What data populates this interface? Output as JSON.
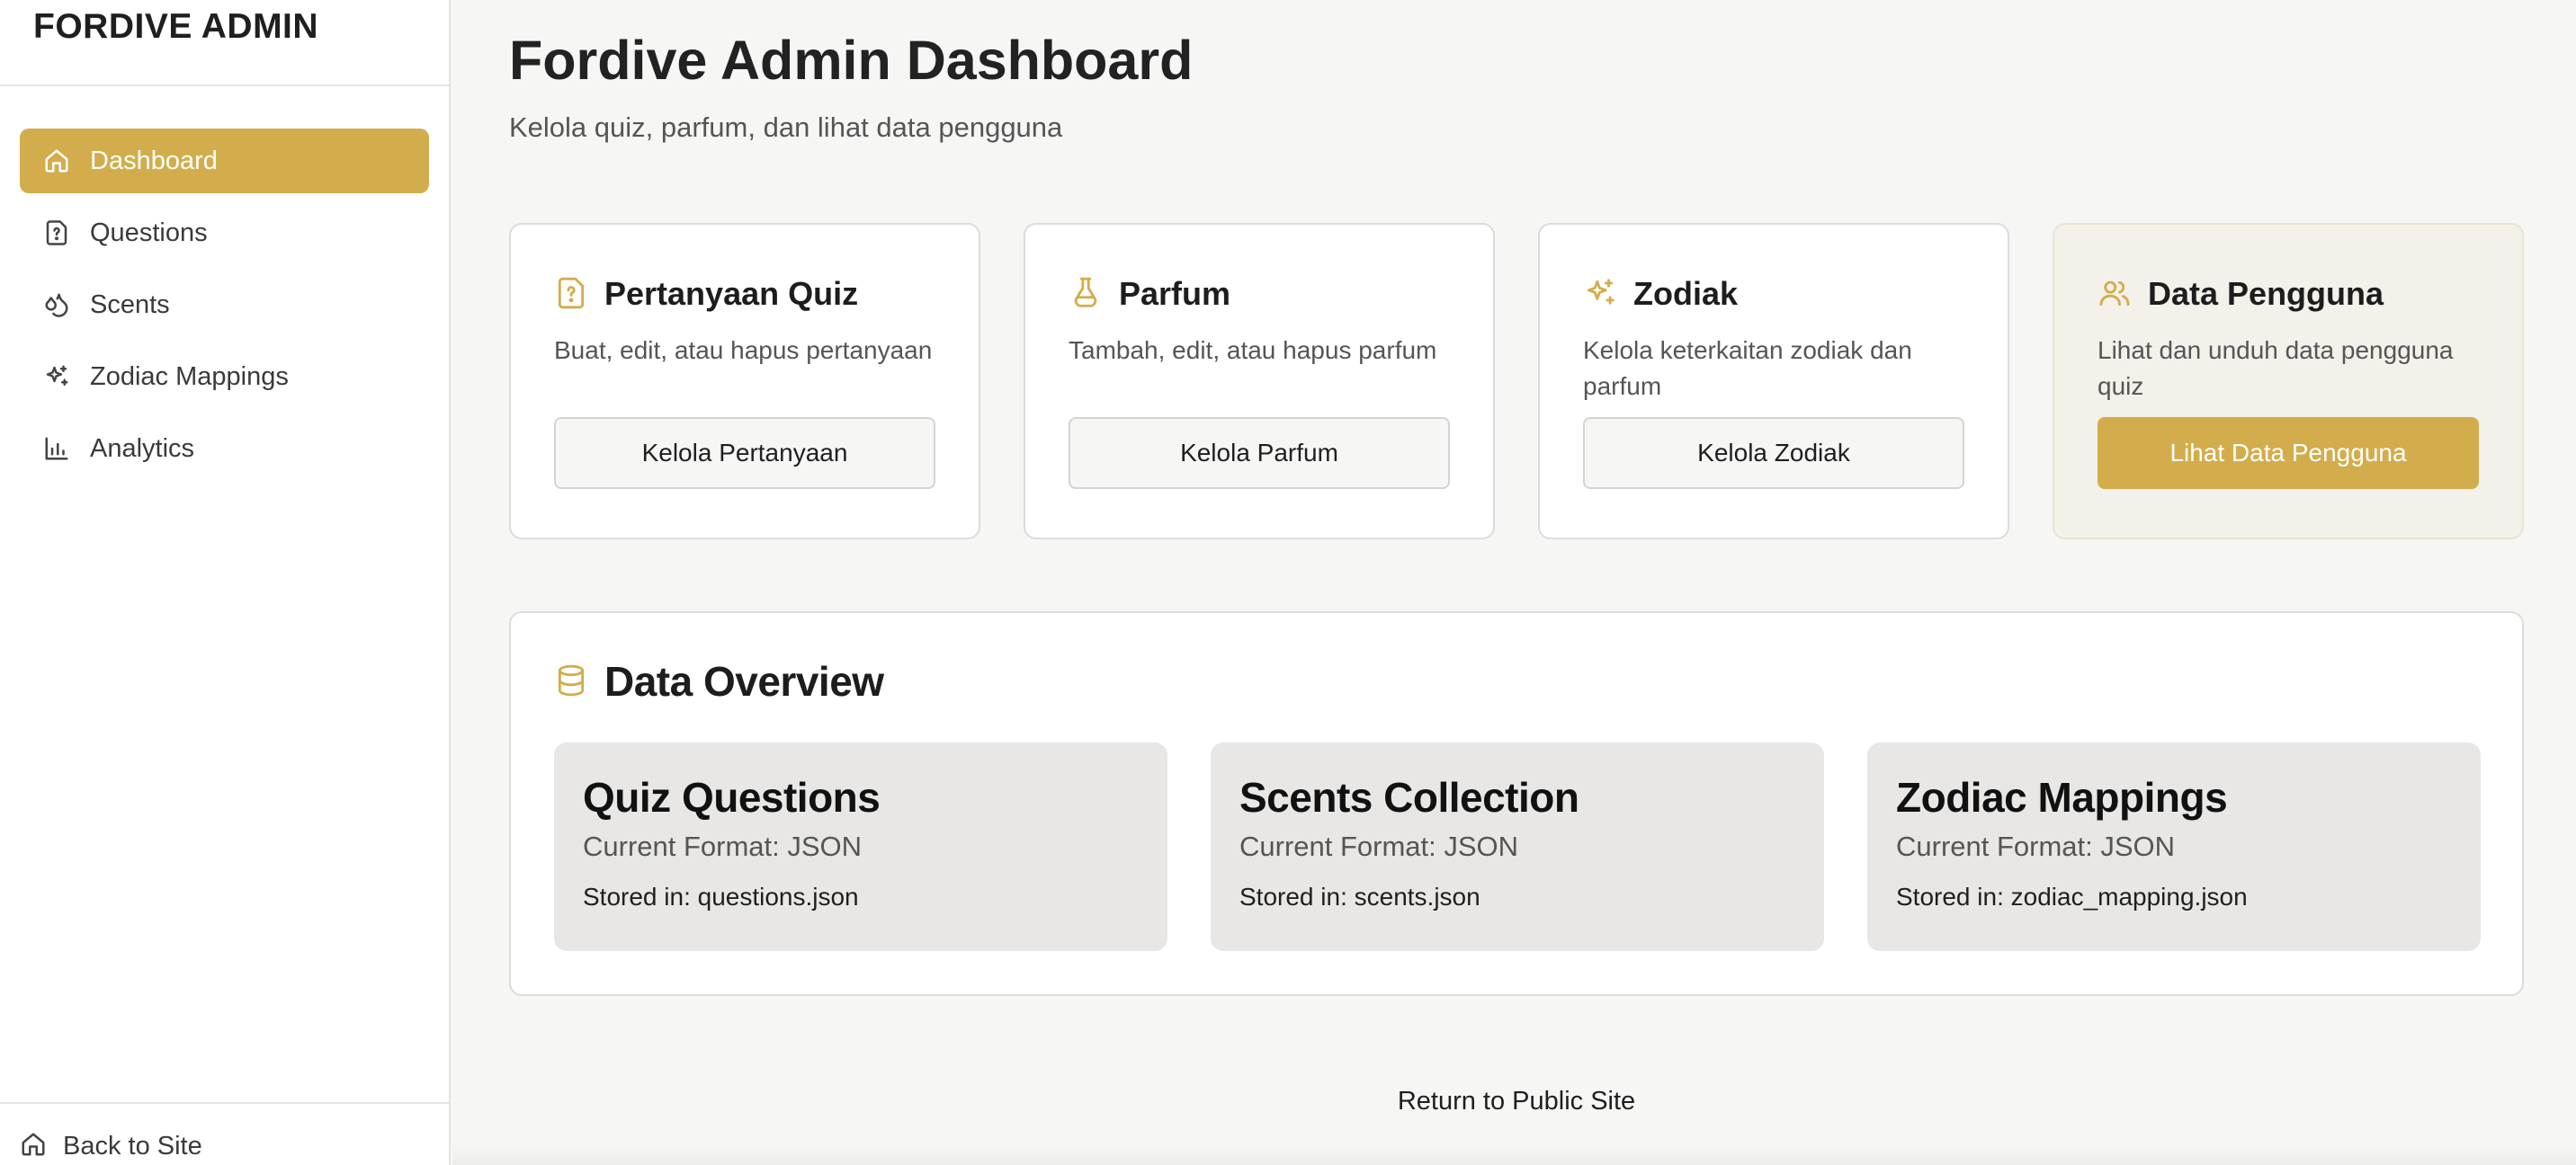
{
  "brand": {
    "name": "FORDIVE ADMIN"
  },
  "sidebar": {
    "items": [
      {
        "label": "Dashboard",
        "icon": "home-icon",
        "active": true
      },
      {
        "label": "Questions",
        "icon": "file-question-icon",
        "active": false
      },
      {
        "label": "Scents",
        "icon": "droplets-icon",
        "active": false
      },
      {
        "label": "Zodiac Mappings",
        "icon": "sparkles-icon",
        "active": false
      },
      {
        "label": "Analytics",
        "icon": "bar-chart-icon",
        "active": false
      }
    ],
    "footer_label": "Back to Site"
  },
  "page": {
    "title": "Fordive Admin Dashboard",
    "subtitle": "Kelola quiz, parfum, dan lihat data pengguna"
  },
  "cards": [
    {
      "title": "Pertanyaan Quiz",
      "description": "Buat, edit, atau hapus pertanyaan",
      "button": "Kelola Pertanyaan",
      "icon": "file-question-icon"
    },
    {
      "title": "Parfum",
      "description": "Tambah, edit, atau hapus parfum",
      "button": "Kelola Parfum",
      "icon": "flask-icon"
    },
    {
      "title": "Zodiak",
      "description": "Kelola keterkaitan zodiak dan parfum",
      "button": "Kelola Zodiak",
      "icon": "sparkles-icon"
    },
    {
      "title": "Data Pengguna",
      "description": "Lihat dan unduh data pengguna quiz",
      "button": "Lihat Data Pengguna",
      "icon": "users-icon"
    }
  ],
  "overview": {
    "title": "Data Overview",
    "icon": "database-icon",
    "stats": [
      {
        "title": "Quiz Questions",
        "format": "Current Format: JSON",
        "stored": "Stored in: questions.json"
      },
      {
        "title": "Scents Collection",
        "format": "Current Format: JSON",
        "stored": "Stored in: scents.json"
      },
      {
        "title": "Zodiac Mappings",
        "format": "Current Format: JSON",
        "stored": "Stored in: zodiac_mapping.json"
      }
    ]
  },
  "footer": {
    "return_link": "Return to Public Site"
  },
  "colors": {
    "accent": "#d3ad4b",
    "background": "#f6f6f5",
    "stat_background": "#e8e7e5",
    "highlight_card": "#f3f1ea"
  }
}
